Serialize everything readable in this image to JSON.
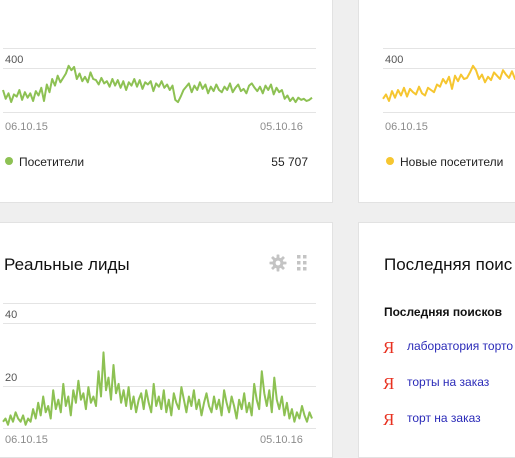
{
  "cards": {
    "visitors": {
      "y_tick": "400",
      "date_start": "06.10.15",
      "date_end": "05.10.16",
      "legend_label": "Посетители",
      "legend_value": "55 707",
      "color": "#8dc153"
    },
    "new_visitors": {
      "y_tick": "400",
      "date_start": "06.10.15",
      "legend_label": "Новые посетители",
      "color": "#f6c630"
    },
    "leads": {
      "title": "Реальные лиды",
      "y_tick_top": "40",
      "y_tick_mid": "20",
      "date_start": "06.10.15",
      "date_end": "05.10.16",
      "color": "#8dc153"
    },
    "search": {
      "title": "Последняя поис",
      "subtitle": "Последняя поисков",
      "items": [
        {
          "engine_icon": "Я",
          "label": "лаборатория торто"
        },
        {
          "engine_icon": "Я",
          "label": "торты на заказ"
        },
        {
          "engine_icon": "Я",
          "label": "торт на заказ"
        }
      ]
    }
  },
  "chart_data": [
    {
      "type": "line",
      "x_range": [
        "06.10.15",
        "05.10.16"
      ],
      "y_ticks": [
        400
      ],
      "ylim": [
        0,
        500
      ],
      "series": [
        {
          "name": "Посетители",
          "color": "#8dc153",
          "values": [
            200,
            120,
            170,
            90,
            160,
            140,
            200,
            110,
            180,
            130,
            170,
            100,
            190,
            150,
            220,
            100,
            250,
            180,
            300,
            240,
            330,
            270,
            310,
            350,
            420,
            380,
            410,
            300,
            350,
            280,
            320,
            270,
            360,
            300,
            290,
            250,
            310,
            260,
            280,
            230,
            300,
            240,
            290,
            220,
            280,
            200,
            270,
            240,
            300,
            230,
            290,
            210,
            270,
            250,
            280,
            190,
            260,
            230,
            280,
            220,
            250,
            200,
            240,
            110,
            90,
            140,
            200,
            230,
            260,
            180,
            240,
            200,
            270,
            210,
            250,
            170,
            230,
            190,
            250,
            200,
            180,
            230,
            200,
            260,
            180,
            220,
            250,
            190,
            210,
            170,
            240,
            260,
            220,
            190,
            230,
            170,
            240,
            200,
            250,
            160,
            220,
            180,
            200,
            120,
            150,
            100,
            130,
            90,
            130,
            110,
            120,
            100,
            110,
            130
          ]
        }
      ]
    },
    {
      "type": "line",
      "x_range": [
        "06.10.15",
        ""
      ],
      "y_ticks": [
        400
      ],
      "ylim": [
        0,
        500
      ],
      "series": [
        {
          "name": "Новые посетители",
          "color": "#f6c630",
          "values": [
            120,
            160,
            100,
            190,
            130,
            200,
            150,
            220,
            140,
            210,
            180,
            160,
            230,
            170,
            150,
            220,
            200,
            180,
            250,
            230,
            300,
            260,
            320,
            210,
            330,
            280,
            340,
            300,
            310,
            360,
            420,
            380,
            300,
            340,
            270,
            320,
            290,
            360,
            330,
            300,
            380,
            340,
            310,
            370,
            300,
            350
          ]
        }
      ]
    },
    {
      "type": "line",
      "title": "Реальные лиды",
      "x_range": [
        "06.10.15",
        "05.10.16"
      ],
      "y_ticks": [
        20,
        40
      ],
      "ylim": [
        0,
        50
      ],
      "series": [
        {
          "color": "#8dc153",
          "values": [
            2,
            3,
            1,
            4,
            2,
            5,
            3,
            2,
            4,
            1,
            3,
            2,
            6,
            3,
            8,
            4,
            10,
            5,
            7,
            3,
            12,
            6,
            9,
            5,
            14,
            7,
            10,
            4,
            12,
            8,
            15,
            9,
            11,
            6,
            13,
            8,
            10,
            7,
            18,
            10,
            24,
            12,
            16,
            9,
            20,
            11,
            14,
            8,
            12,
            7,
            13,
            6,
            10,
            5,
            9,
            11,
            6,
            12,
            8,
            5,
            14,
            7,
            10,
            6,
            12,
            5,
            9,
            4,
            11,
            8,
            6,
            13,
            9,
            5,
            10,
            7,
            12,
            6,
            9,
            4,
            8,
            11,
            7,
            5,
            10,
            6,
            9,
            4,
            12,
            8,
            5,
            10,
            7,
            3,
            9,
            6,
            11,
            5,
            8,
            4,
            14,
            9,
            6,
            18,
            11,
            7,
            12,
            5,
            16,
            9,
            6,
            10,
            4,
            8,
            3,
            6,
            2,
            5,
            3,
            7,
            4,
            2,
            5,
            3
          ]
        }
      ]
    }
  ]
}
